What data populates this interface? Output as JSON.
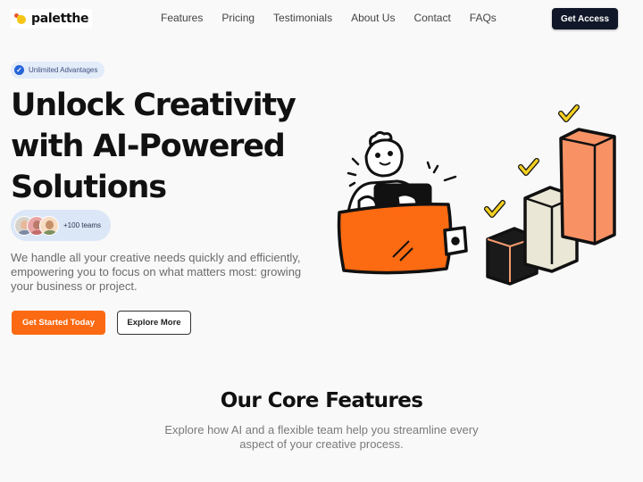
{
  "brand": {
    "name": "paletthe",
    "logo_icon": "palette-blob-logo",
    "colors": {
      "accent": "#fb6a12",
      "dark": "#101728",
      "badge_blue": "#2563d9",
      "logo_yellow": "#f5c518"
    }
  },
  "nav": {
    "items": [
      {
        "label": "Features"
      },
      {
        "label": "Pricing"
      },
      {
        "label": "Testimonials"
      },
      {
        "label": "About Us"
      },
      {
        "label": "Contact"
      },
      {
        "label": "FAQs"
      }
    ],
    "cta_label": "Get Access"
  },
  "hero": {
    "badge": {
      "icon": "check-circle-icon",
      "label": "Unlimited Advantages"
    },
    "title": "Unlock Creativity with AI-Powered Solutions",
    "social_proof": {
      "avatars": 3,
      "label": "+100 teams"
    },
    "description": "We handle all your creative needs quickly and efficiently, empowering you to focus on what matters most: growing your business or project.",
    "primary_button": "Get Started Today",
    "secondary_button": "Explore More",
    "illustration": "person-in-wallet-with-growth-bars"
  },
  "features": {
    "title": "Our Core Features",
    "description": "Explore how AI and a flexible team help you streamline every aspect of your creative process."
  }
}
